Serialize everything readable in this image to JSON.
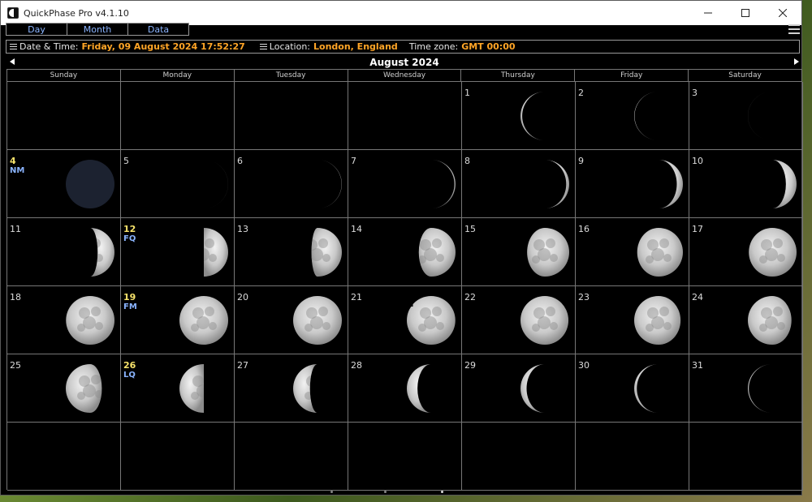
{
  "window": {
    "title": "QuickPhase Pro v4.1.10",
    "minimize_icon": "minimize-icon",
    "maximize_icon": "maximize-icon",
    "close_icon": "close-icon"
  },
  "tabs": [
    {
      "label": "Day"
    },
    {
      "label": "Month"
    },
    {
      "label": "Data"
    }
  ],
  "info": {
    "datetime_label": "Date & Time:",
    "datetime_value": "Friday, 09 August 2024 17:52:27",
    "location_label": "Location:",
    "location_value": "London, England",
    "timezone_label": "Time zone:",
    "timezone_value": "GMT 00:00"
  },
  "calendar": {
    "month_title": "August 2024",
    "weekdays": [
      "Sunday",
      "Monday",
      "Tuesday",
      "Wednesday",
      "Thursday",
      "Friday",
      "Saturday"
    ],
    "first_weekday_index": 4,
    "total_cells": 42,
    "days": [
      {
        "day": "1",
        "illum": 0.12,
        "waxing": false,
        "label": ""
      },
      {
        "day": "2",
        "illum": 0.06,
        "waxing": false,
        "label": ""
      },
      {
        "day": "3",
        "illum": 0.02,
        "waxing": false,
        "label": ""
      },
      {
        "day": "4",
        "illum": 0.0,
        "waxing": true,
        "label": "NM"
      },
      {
        "day": "5",
        "illum": 0.02,
        "waxing": true,
        "label": ""
      },
      {
        "day": "6",
        "illum": 0.05,
        "waxing": true,
        "label": ""
      },
      {
        "day": "7",
        "illum": 0.1,
        "waxing": true,
        "label": ""
      },
      {
        "day": "8",
        "illum": 0.16,
        "waxing": true,
        "label": ""
      },
      {
        "day": "9",
        "illum": 0.23,
        "waxing": true,
        "label": ""
      },
      {
        "day": "10",
        "illum": 0.31,
        "waxing": true,
        "label": ""
      },
      {
        "day": "11",
        "illum": 0.4,
        "waxing": true,
        "label": ""
      },
      {
        "day": "12",
        "illum": 0.5,
        "waxing": true,
        "label": "FQ"
      },
      {
        "day": "13",
        "illum": 0.58,
        "waxing": true,
        "label": ""
      },
      {
        "day": "14",
        "illum": 0.67,
        "waxing": true,
        "label": ""
      },
      {
        "day": "15",
        "illum": 0.76,
        "waxing": true,
        "label": ""
      },
      {
        "day": "16",
        "illum": 0.84,
        "waxing": true,
        "label": ""
      },
      {
        "day": "17",
        "illum": 0.91,
        "waxing": true,
        "label": ""
      },
      {
        "day": "18",
        "illum": 0.96,
        "waxing": true,
        "label": ""
      },
      {
        "day": "19",
        "illum": 1.0,
        "waxing": true,
        "label": "FM"
      },
      {
        "day": "20",
        "illum": 0.99,
        "waxing": false,
        "label": ""
      },
      {
        "day": "21",
        "illum": 0.96,
        "waxing": false,
        "label": ""
      },
      {
        "day": "22",
        "illum": 0.92,
        "waxing": false,
        "label": ""
      },
      {
        "day": "23",
        "illum": 0.86,
        "waxing": false,
        "label": ""
      },
      {
        "day": "24",
        "illum": 0.79,
        "waxing": false,
        "label": ""
      },
      {
        "day": "25",
        "illum": 0.66,
        "waxing": false,
        "label": ""
      },
      {
        "day": "26",
        "illum": 0.5,
        "waxing": false,
        "label": "LQ"
      },
      {
        "day": "27",
        "illum": 0.4,
        "waxing": false,
        "label": ""
      },
      {
        "day": "28",
        "illum": 0.31,
        "waxing": false,
        "label": ""
      },
      {
        "day": "29",
        "illum": 0.23,
        "waxing": false,
        "label": ""
      },
      {
        "day": "30",
        "illum": 0.15,
        "waxing": false,
        "label": ""
      },
      {
        "day": "31",
        "illum": 0.09,
        "waxing": false,
        "label": ""
      }
    ]
  },
  "colors": {
    "accent_orange": "#ffa526",
    "tab_blue": "#8ab4ff",
    "special_day": "#f7e36b",
    "grid_line": "#777777"
  }
}
